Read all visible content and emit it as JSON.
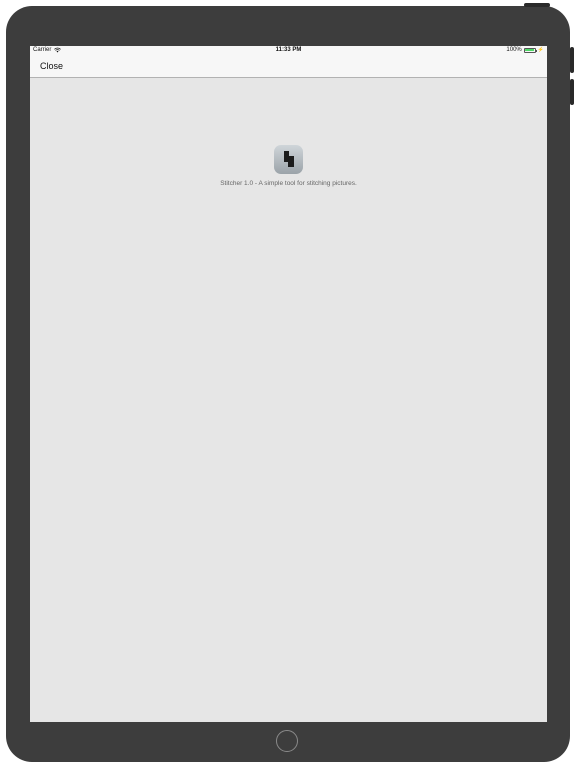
{
  "status_bar": {
    "carrier": "Carrier",
    "time": "11:33 PM",
    "battery": "100%",
    "icons": [
      "wifi-icon",
      "battery-icon",
      "charging-bolt-icon"
    ]
  },
  "nav_bar": {
    "close_label": "Close"
  },
  "about": {
    "app_icon": "stitcher-app-icon",
    "text": "Stitcher 1.0 - A simple tool for stitching pictures."
  },
  "colors": {
    "device_frame": "#3d3d3d",
    "screen_background": "#e6e6e6",
    "nav_background": "#f7f7f7",
    "battery_fill": "#4cd964"
  }
}
